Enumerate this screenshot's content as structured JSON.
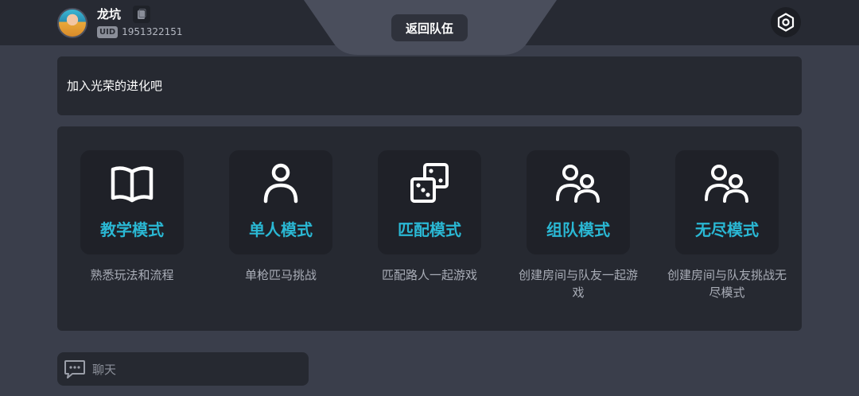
{
  "user": {
    "name": "龙坑",
    "uid_label": "UID",
    "uid": "1951322151"
  },
  "header": {
    "back_to_team_label": "返回队伍"
  },
  "announcement": {
    "text": "加入光荣的进化吧"
  },
  "modes": [
    {
      "title": "教学模式",
      "desc": "熟悉玩法和流程",
      "icon": "book-icon"
    },
    {
      "title": "单人模式",
      "desc": "单枪匹马挑战",
      "icon": "user-icon"
    },
    {
      "title": "匹配模式",
      "desc": "匹配路人一起游戏",
      "icon": "dice-icon"
    },
    {
      "title": "组队模式",
      "desc": "创建房间与队友一起游戏",
      "icon": "users-icon"
    },
    {
      "title": "无尽模式",
      "desc": "创建房间与队友挑战无尽模式",
      "icon": "users-icon"
    }
  ],
  "chat": {
    "placeholder": "聊天",
    "icon": "chat-icon"
  },
  "colors": {
    "accent": "#2ab8d4",
    "background": "#3a3e4b",
    "panel": "#262931",
    "card": "#1f2128"
  }
}
